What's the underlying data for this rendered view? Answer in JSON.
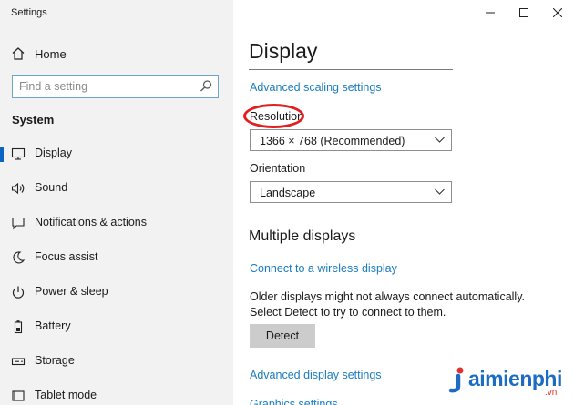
{
  "window": {
    "title": "Settings"
  },
  "sidebar": {
    "home_label": "Home",
    "search_placeholder": "Find a setting",
    "section": "System",
    "items": [
      {
        "label": "Display",
        "icon": "monitor-icon",
        "active": true
      },
      {
        "label": "Sound",
        "icon": "speaker-icon"
      },
      {
        "label": "Notifications & actions",
        "icon": "notification-icon"
      },
      {
        "label": "Focus assist",
        "icon": "moon-icon"
      },
      {
        "label": "Power & sleep",
        "icon": "power-icon"
      },
      {
        "label": "Battery",
        "icon": "battery-icon"
      },
      {
        "label": "Storage",
        "icon": "storage-icon"
      },
      {
        "label": "Tablet mode",
        "icon": "tablet-icon"
      }
    ]
  },
  "main": {
    "title": "Display",
    "advanced_scaling_link": "Advanced scaling settings",
    "resolution": {
      "label": "Resolution",
      "value": "1366 × 768 (Recommended)"
    },
    "orientation": {
      "label": "Orientation",
      "value": "Landscape"
    },
    "multiple_displays": {
      "heading": "Multiple displays",
      "connect_link": "Connect to a wireless display",
      "description": "Older displays might not always connect automatically. Select Detect to try to connect to them.",
      "detect_label": "Detect"
    },
    "advanced_display_link": "Advanced display settings",
    "graphics_link": "Graphics settings"
  },
  "watermark": {
    "brand": "aimienphi",
    "suffix": ".vn"
  },
  "colors": {
    "accent": "#0a66c2",
    "link": "#1a7bbf",
    "highlight": "#e02020",
    "brand": "#1c6cc3"
  }
}
